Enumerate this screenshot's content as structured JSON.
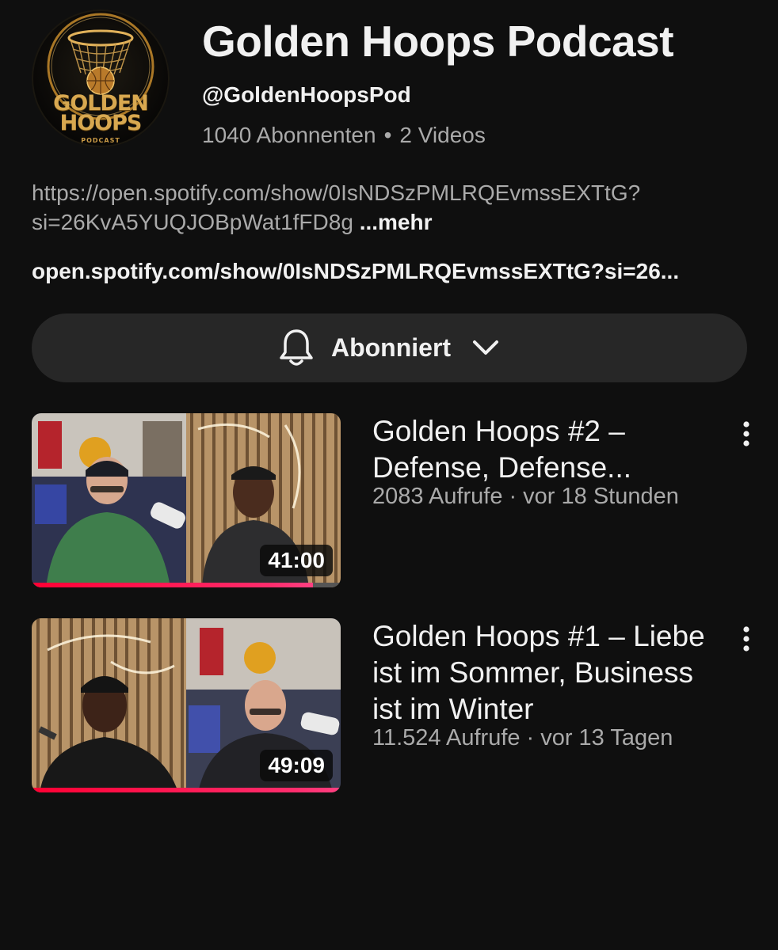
{
  "channel": {
    "logo_line1": "GOLDEN",
    "logo_line2": "HOOPS",
    "logo_line3": "PODCAST",
    "title": "Golden Hoops Podcast",
    "handle": "@GoldenHoopsPod",
    "subscribers": "1040 Abonnenten",
    "separator": "•",
    "video_count": "2 Videos"
  },
  "description": {
    "text": "https://open.spotify.com/show/0IsNDSzPMLRQEvmssEXTtG?si=26KvA5YUQJOBpWat1fFD8g",
    "more_label": "...mehr"
  },
  "link": {
    "text": "open.spotify.com/show/0IsNDSzPMLRQEvmssEXTtG?si=26..."
  },
  "subscribe": {
    "label": "Abonniert",
    "icon": "bell-icon"
  },
  "videos": [
    {
      "title": "Golden Hoops #2 – Defense, Defense...",
      "views": "2083 Aufrufe",
      "separator": "·",
      "age": "vor 18 Stunden",
      "duration": "41:00",
      "watched_fraction": 0.91
    },
    {
      "title": "Golden Hoops #1 – Liebe ist im Sommer, Business ist im Winter",
      "views": "11.524 Aufrufe",
      "separator": "·",
      "age": "vor 13 Tagen",
      "duration": "49:09",
      "watched_fraction": 1.0
    }
  ],
  "colors": {
    "background": "#0f0f0f",
    "text_primary": "#f1f1f1",
    "text_secondary": "#aaaaaa",
    "button_bg": "#272727",
    "progress": "#ff0033",
    "logo_gold": "#d8a850"
  }
}
